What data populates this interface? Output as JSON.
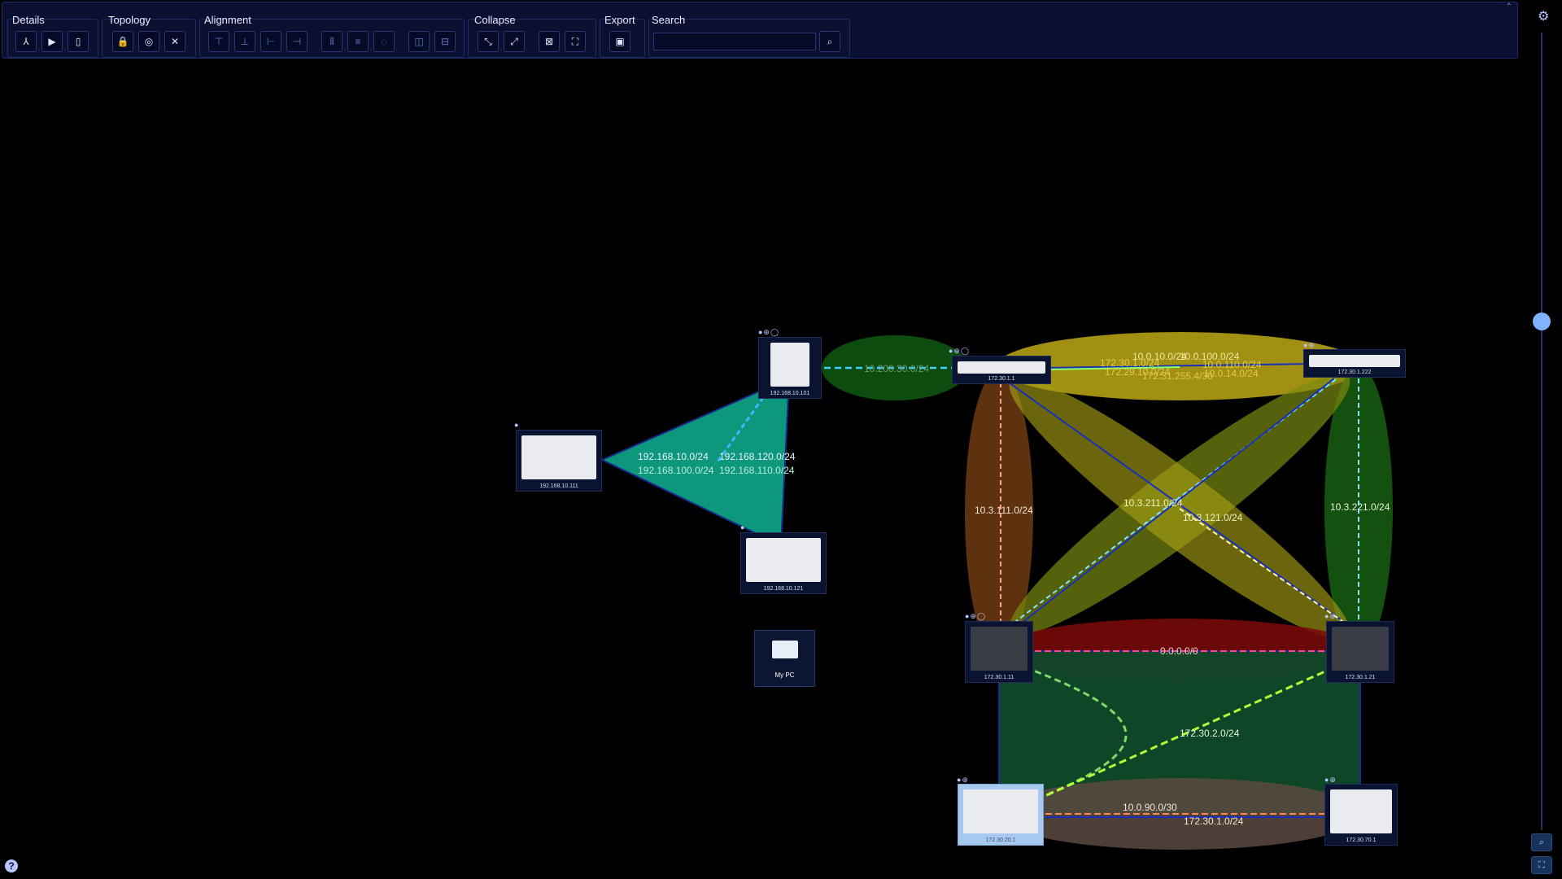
{
  "toolbar": {
    "details_title": "Details",
    "topology_title": "Topology",
    "alignment_title": "Alignment",
    "collapse_title": "Collapse",
    "export_title": "Export",
    "search_title": "Search",
    "search_placeholder": ""
  },
  "nodes": {
    "n_192_101": "192.168.10.101",
    "n_192_111": "192.168.10.111",
    "n_192_121": "192.168.10.121",
    "n_172_1_1": "172.30.1.1",
    "n_172_1_222": "172.30.1.222",
    "n_172_11": "172.30.1.11",
    "n_172_21": "172.30.1.21",
    "n_172_201": "172.30.20.1",
    "n_172_701": "172.30.70.1",
    "my_pc": "My PC"
  },
  "subnets": {
    "s1": "192.168.10.0/24",
    "s2": "192.168.100.0/24",
    "s3": "192.168.120.0/24",
    "s4": "192.168.110.0/24",
    "s5": "10.200.30.0/24",
    "s6": "10.0.10.0/24",
    "s7": "10.0.100.0/24",
    "s8": "172.30.1.0/24",
    "s9": "172.29.10.0/24",
    "s10": "10.0.110.0/24",
    "s11": "172.31.255.4/30",
    "s12": "10.0.14.0/24",
    "s13": "10.3.111.0/24",
    "s14": "10.3.211.0/24",
    "s15": "10.3.121.0/24",
    "s16": "10.3.221.0/24",
    "s17": "0.0.0.0/0",
    "s18": "172.30.2.0/24",
    "s19": "10.0.90.0/30",
    "s20": "172.30.1.0/24"
  }
}
